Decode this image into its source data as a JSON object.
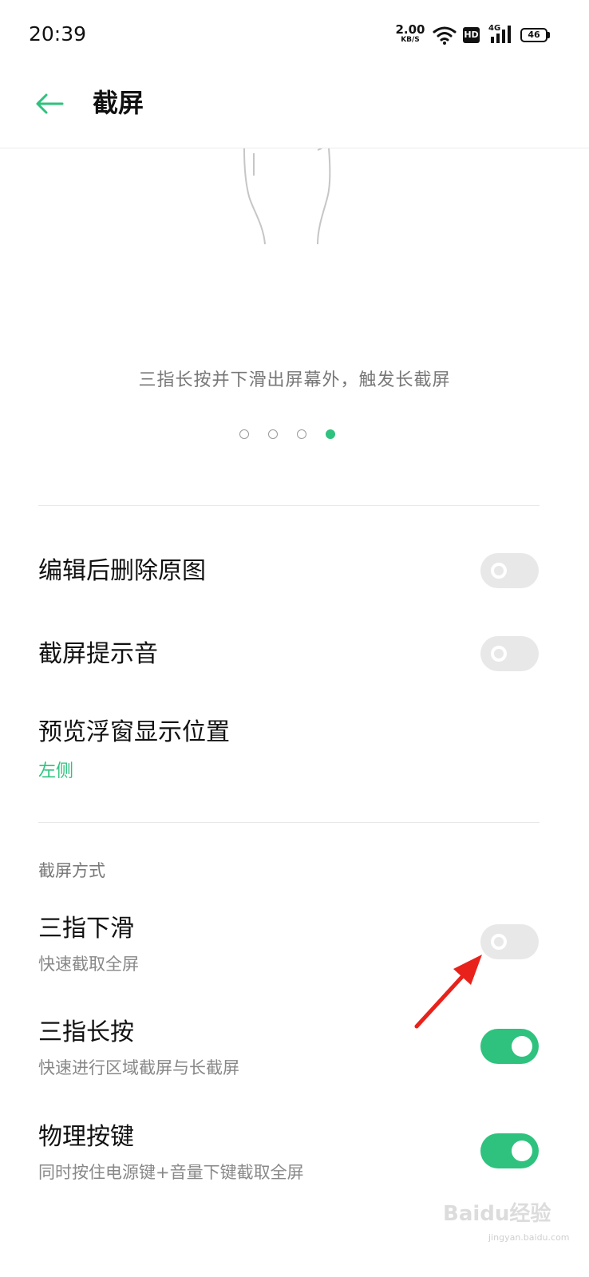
{
  "status_bar": {
    "time": "20:39",
    "net_speed_value": "2.00",
    "net_speed_unit": "KB/S",
    "hd": "HD",
    "network": "4G",
    "battery": "46"
  },
  "header": {
    "back_icon": "arrow-left-icon",
    "title": "截屏"
  },
  "carousel": {
    "caption": "三指长按并下滑出屏幕外，触发长截屏",
    "page_count": 4,
    "active_index": 3
  },
  "settings": {
    "delete_original": {
      "title": "编辑后删除原图",
      "enabled": false
    },
    "shutter_sound": {
      "title": "截屏提示音",
      "enabled": false
    },
    "preview_position": {
      "title": "预览浮窗显示位置",
      "value": "左侧"
    }
  },
  "methods": {
    "header": "截屏方式",
    "three_finger_swipe": {
      "title": "三指下滑",
      "subtitle": "快速截取全屏",
      "enabled": false
    },
    "three_finger_hold": {
      "title": "三指长按",
      "subtitle": "快速进行区域截屏与长截屏",
      "enabled": true
    },
    "physical_keys": {
      "title": "物理按键",
      "subtitle": "同时按住电源键+音量下键截取全屏",
      "enabled": true
    }
  },
  "colors": {
    "accent": "#2ec27e",
    "annotation": "#e8221b"
  },
  "watermark": {
    "brand": "Baidu经验",
    "url": "jingyan.baidu.com"
  }
}
